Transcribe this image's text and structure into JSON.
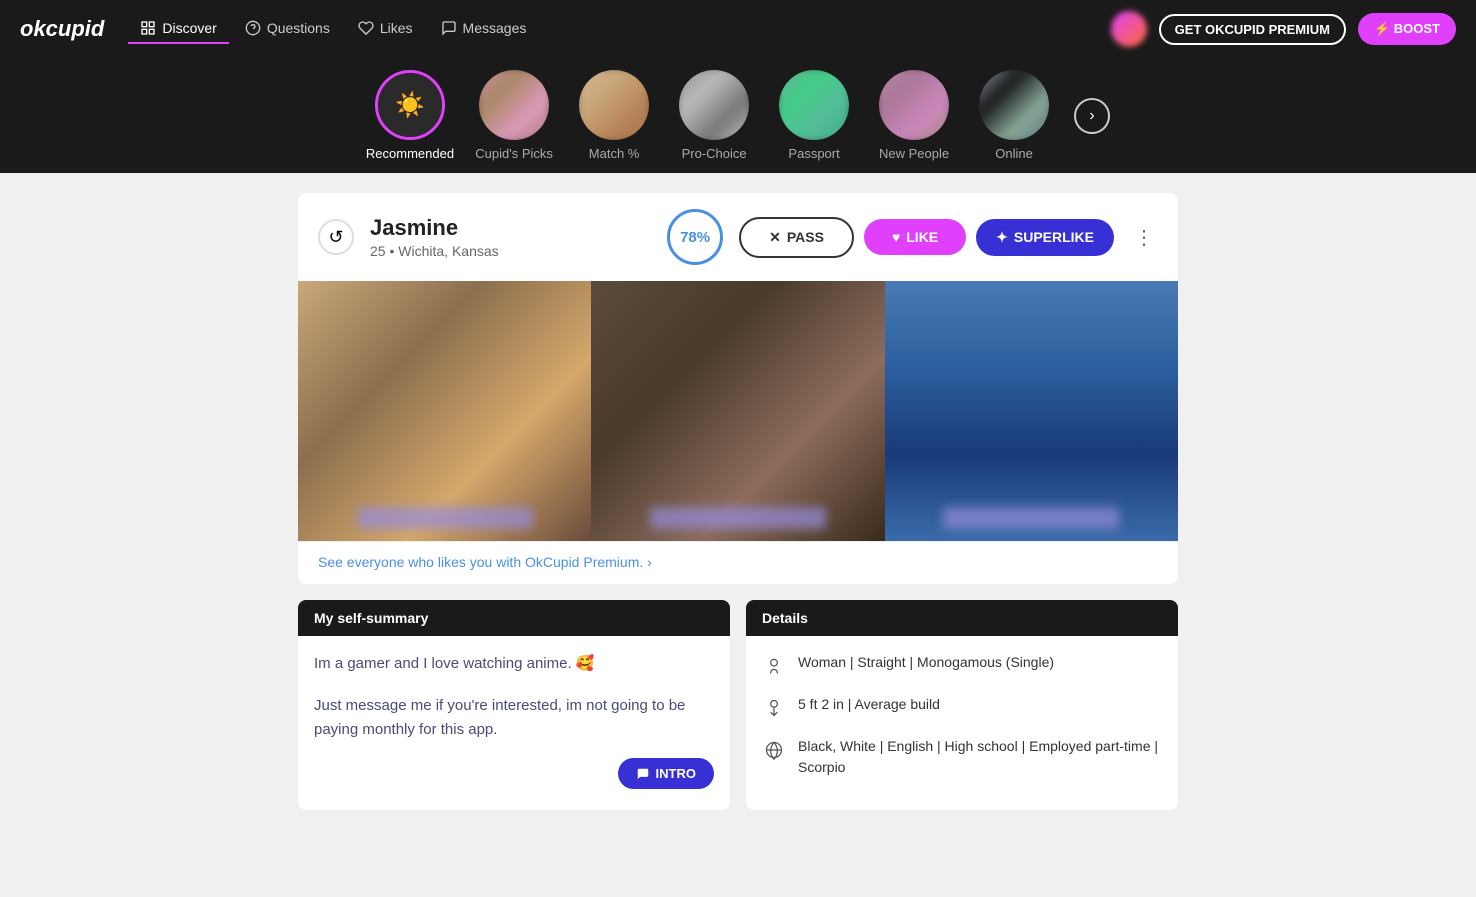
{
  "app": {
    "logo": "okcupid",
    "premium_btn": "GET OKCUPID PREMIUM",
    "boost_btn": "⚡ BOOST"
  },
  "nav": {
    "items": [
      {
        "id": "discover",
        "label": "Discover",
        "active": true
      },
      {
        "id": "questions",
        "label": "Questions",
        "active": false
      },
      {
        "id": "likes",
        "label": "Likes",
        "active": false
      },
      {
        "id": "messages",
        "label": "Messages",
        "active": false
      }
    ]
  },
  "categories": [
    {
      "id": "recommended",
      "label": "Recommended",
      "active": true,
      "type": "icon"
    },
    {
      "id": "cupids-picks",
      "label": "Cupid's Picks",
      "active": false,
      "type": "blurred"
    },
    {
      "id": "match",
      "label": "Match %",
      "active": false,
      "type": "blurred"
    },
    {
      "id": "pro-choice",
      "label": "Pro-Choice",
      "active": false,
      "type": "blurred"
    },
    {
      "id": "passport",
      "label": "Passport",
      "active": false,
      "type": "blurred"
    },
    {
      "id": "new-people",
      "label": "New People",
      "active": false,
      "type": "blurred"
    },
    {
      "id": "online",
      "label": "Online",
      "active": false,
      "type": "blurred"
    }
  ],
  "profile": {
    "name": "Jasmine",
    "age": "25",
    "location": "Wichita, Kansas",
    "match_percent": "78%",
    "pass_label": "PASS",
    "like_label": "LIKE",
    "superlike_label": "SUPERLIKE",
    "premium_link": "See everyone who likes you with OkCupid Premium. ›"
  },
  "self_summary": {
    "header": "My self-summary",
    "text1": "Im a gamer and I love watching anime. 🥰",
    "text2": "Just message me if you're interested, im not going to be paying monthly for this app.",
    "intro_btn": "INTRO"
  },
  "details": {
    "header": "Details",
    "items": [
      {
        "icon": "♀",
        "text": "Woman | Straight | Monogamous (Single)"
      },
      {
        "icon": "↕",
        "text": "5 ft 2 in | Average build"
      },
      {
        "icon": "🌐",
        "text": "Black, White | English | High school | Employed part-time | Scorpio"
      }
    ]
  }
}
